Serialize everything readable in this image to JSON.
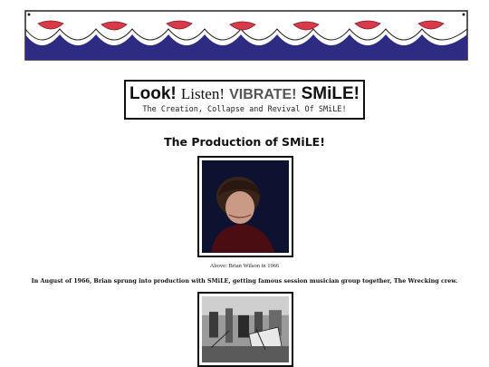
{
  "header": {
    "word_look": "Look!",
    "word_listen": "Listen!",
    "word_vibrate": "VIBRATE!",
    "word_smile": "SMiLE!",
    "subtitle": "The Creation, Collapse and Revival Of SMiLE!"
  },
  "section": {
    "heading": "The Production of SMiLE!"
  },
  "photo1": {
    "caption": "Above: Brian Wilson in 1966"
  },
  "body": {
    "paragraph": "In August of 1966, Brian sprung into production with SMiLE, getting famous session musician group together, The Wrecking crew."
  },
  "colors": {
    "banner_blue": "#2e2c82",
    "lips_red": "#d83a4a",
    "text": "#111111"
  }
}
